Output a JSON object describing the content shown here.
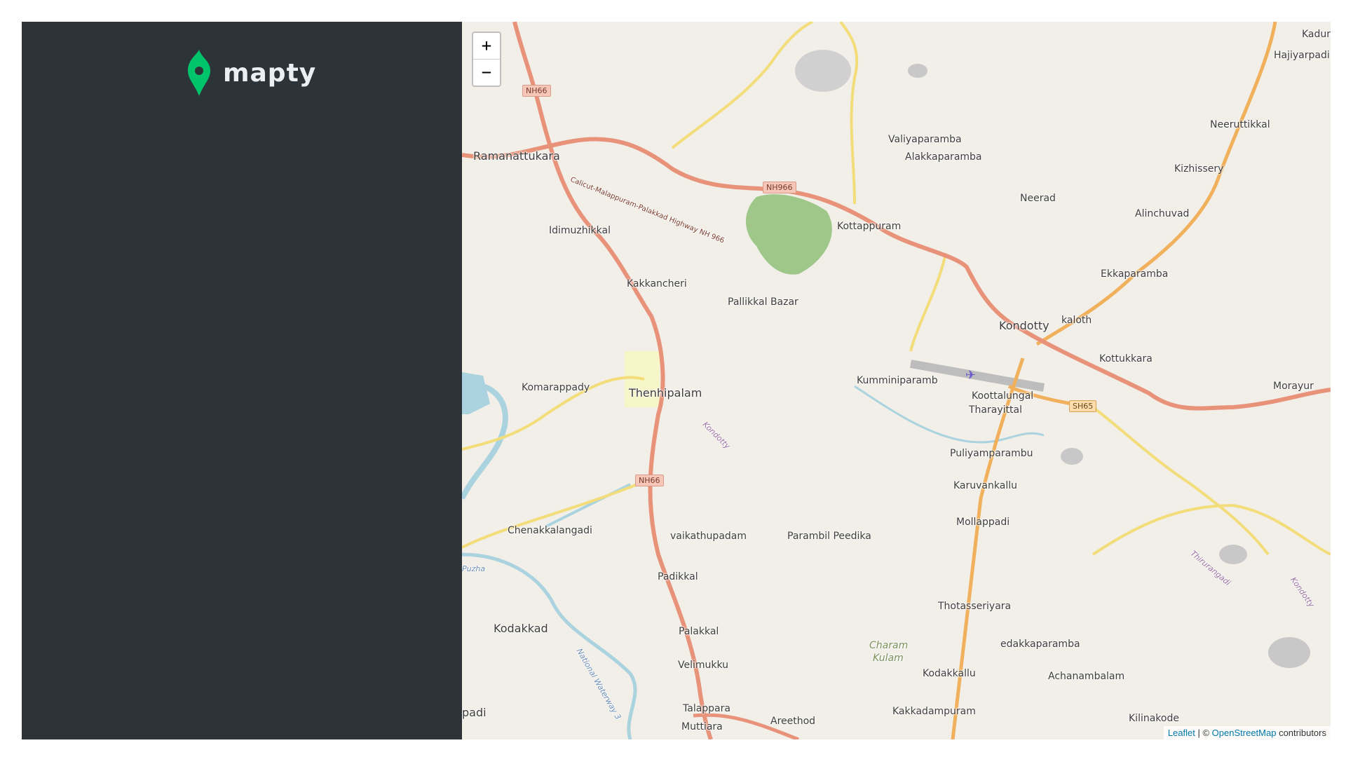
{
  "app": {
    "logo_text": "mapty",
    "logo_icon": "map-pin-icon",
    "accent": "#00c46a"
  },
  "zoom": {
    "in": "+",
    "out": "−"
  },
  "attribution": {
    "leaflet": "Leaflet",
    "separator": " | © ",
    "osm": "OpenStreetMap",
    "suffix": " contributors"
  },
  "places": [
    {
      "name": "Ramanattukara",
      "big": true
    },
    {
      "name": "Idimuzhikkal"
    },
    {
      "name": "Kakkancheri"
    },
    {
      "name": "Pallikkal Bazar"
    },
    {
      "name": "Kottappuram"
    },
    {
      "name": "Valiyaparamba"
    },
    {
      "name": "Alakkaparamba"
    },
    {
      "name": "Neerad"
    },
    {
      "name": "Kizhissery"
    },
    {
      "name": "Neeruttikkal"
    },
    {
      "name": "Hajiyarpadi"
    },
    {
      "name": "Kadun"
    },
    {
      "name": "Alinchuvad"
    },
    {
      "name": "Ekkaparamba"
    },
    {
      "name": "Kondotty",
      "big": true
    },
    {
      "name": "kaloth"
    },
    {
      "name": "Kottukkara"
    },
    {
      "name": "Morayur"
    },
    {
      "name": "Kumminiparamb"
    },
    {
      "name": "Koottalungal"
    },
    {
      "name": "Tharayittal"
    },
    {
      "name": "Komarappady"
    },
    {
      "name": "Thenhipalam",
      "big": true
    },
    {
      "name": "Puliyamparambu"
    },
    {
      "name": "Karuvankallu"
    },
    {
      "name": "Mollappadi"
    },
    {
      "name": "Chenakkalangadi"
    },
    {
      "name": "vaikathupadam"
    },
    {
      "name": "Parambil Peedika"
    },
    {
      "name": "Padikkal"
    },
    {
      "name": "Kodakkad"
    },
    {
      "name": "Palakkal"
    },
    {
      "name": "Velimukku"
    },
    {
      "name": "Thotasseriyara"
    },
    {
      "name": "edakkaparamba"
    },
    {
      "name": "Achanambalam"
    },
    {
      "name": "Kodakkallu"
    },
    {
      "name": "Kakkadampuram"
    },
    {
      "name": "Kilinakode"
    },
    {
      "name": "Talappara"
    },
    {
      "name": "Muttiara"
    },
    {
      "name": "Areethod"
    },
    {
      "name": "padi",
      "big": true
    }
  ],
  "shields": [
    "NH66",
    "NH966",
    "SH65",
    "NH66"
  ],
  "road_labels": [
    "Calicut-Malappuram-Palakkad Highway NH 966"
  ],
  "water_labels": [
    "Kondotty",
    "Kondotty",
    "National Waterway 3",
    "Puzha",
    "Thirurangadi"
  ],
  "natural_labels": [
    "Charam",
    "Kulam"
  ],
  "colors": {
    "land": "#f2efe9",
    "trunk_road": "#e8927a",
    "secondary_road": "#f3dd7a",
    "primary_road": "#f1b05c",
    "water": "#aad3df",
    "forest": "#9fc78a",
    "sidebar": "#2d3439"
  }
}
